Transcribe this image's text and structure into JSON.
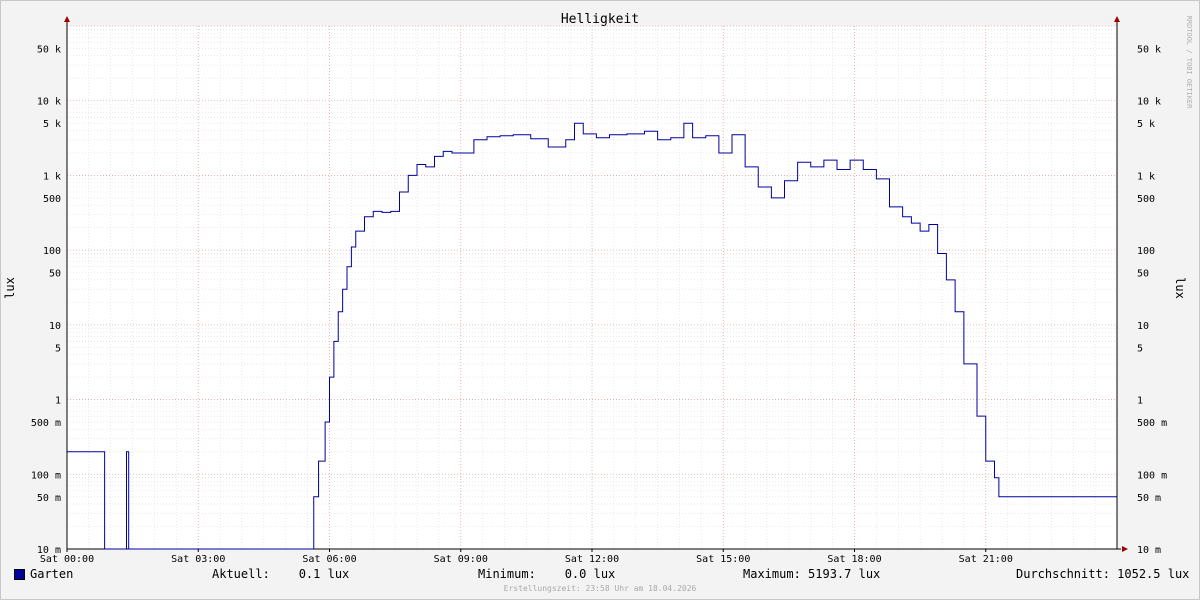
{
  "chart_data": {
    "type": "line",
    "title": "Helligkeit",
    "ylabel": "lux",
    "yscale": "log",
    "ylim": [
      0.01,
      100000
    ],
    "xlim": [
      0,
      24
    ],
    "grid": true,
    "watermark": "RRDTOOL / TOBI OETIKER",
    "x_ticks": [
      {
        "hour": 0,
        "label": "Sat 00:00"
      },
      {
        "hour": 3,
        "label": "Sat 03:00"
      },
      {
        "hour": 6,
        "label": "Sat 06:00"
      },
      {
        "hour": 9,
        "label": "Sat 09:00"
      },
      {
        "hour": 12,
        "label": "Sat 12:00"
      },
      {
        "hour": 15,
        "label": "Sat 15:00"
      },
      {
        "hour": 18,
        "label": "Sat 18:00"
      },
      {
        "hour": 21,
        "label": "Sat 21:00"
      }
    ],
    "y_ticks": [
      {
        "value": 50000,
        "label": "50 k"
      },
      {
        "value": 10000,
        "label": "10 k"
      },
      {
        "value": 5000,
        "label": "5 k"
      },
      {
        "value": 1000,
        "label": "1 k"
      },
      {
        "value": 500,
        "label": "500"
      },
      {
        "value": 100,
        "label": "100"
      },
      {
        "value": 50,
        "label": "50"
      },
      {
        "value": 10,
        "label": "10"
      },
      {
        "value": 5,
        "label": "5"
      },
      {
        "value": 1,
        "label": "1"
      },
      {
        "value": 0.5,
        "label": "500 m"
      },
      {
        "value": 0.1,
        "label": "100 m"
      },
      {
        "value": 0.05,
        "label": "50 m"
      },
      {
        "value": 0.01,
        "label": "10 m"
      }
    ],
    "series": [
      {
        "name": "Garten",
        "color": "#0000a0",
        "x": [
          0.0,
          0.85,
          0.86,
          1.35,
          1.36,
          1.4,
          1.41,
          5.63,
          5.64,
          5.74,
          5.75,
          5.9,
          6.0,
          6.1,
          6.2,
          6.3,
          6.4,
          6.5,
          6.6,
          6.8,
          7.0,
          7.2,
          7.4,
          7.6,
          7.8,
          8.0,
          8.2,
          8.4,
          8.6,
          8.8,
          9.0,
          9.3,
          9.6,
          9.9,
          10.2,
          10.6,
          11.0,
          11.4,
          11.6,
          11.8,
          12.1,
          12.4,
          12.8,
          13.2,
          13.5,
          13.8,
          14.1,
          14.3,
          14.6,
          14.9,
          15.2,
          15.5,
          15.8,
          16.1,
          16.4,
          16.7,
          17.0,
          17.3,
          17.6,
          17.9,
          18.2,
          18.5,
          18.8,
          19.1,
          19.3,
          19.5,
          19.7,
          19.9,
          20.1,
          20.3,
          20.5,
          20.8,
          21.0,
          21.2,
          21.3,
          21.4,
          21.5,
          21.6,
          24.0
        ],
        "values": [
          0.2,
          0.2,
          0.01,
          0.01,
          0.2,
          0.2,
          0.01,
          0.01,
          0.05,
          0.05,
          0.15,
          0.5,
          2,
          6,
          15,
          30,
          60,
          110,
          180,
          280,
          330,
          320,
          330,
          600,
          1000,
          1400,
          1300,
          1800,
          2100,
          2000,
          2000,
          3000,
          3300,
          3400,
          3500,
          3100,
          2400,
          3000,
          5000,
          3600,
          3200,
          3500,
          3600,
          3900,
          3000,
          3200,
          5000,
          3200,
          3400,
          2000,
          3500,
          1300,
          700,
          500,
          850,
          1500,
          1300,
          1600,
          1200,
          1600,
          1200,
          900,
          380,
          280,
          230,
          180,
          220,
          90,
          40,
          15,
          3,
          0.6,
          0.15,
          0.09,
          0.05,
          0.05,
          0.05,
          0.05,
          0.05
        ]
      }
    ]
  },
  "legend": {
    "series_name": "Garten",
    "aktuell": "Aktuell:    0.1 lux",
    "minimum": "Minimum:    0.0 lux",
    "maximum": "Maximum: 5193.7 lux",
    "durchschnitt": "Durchschnitt: 1052.5 lux"
  },
  "footer": "Erstellungszeit: 23:58 Uhr am 18.04.2026"
}
